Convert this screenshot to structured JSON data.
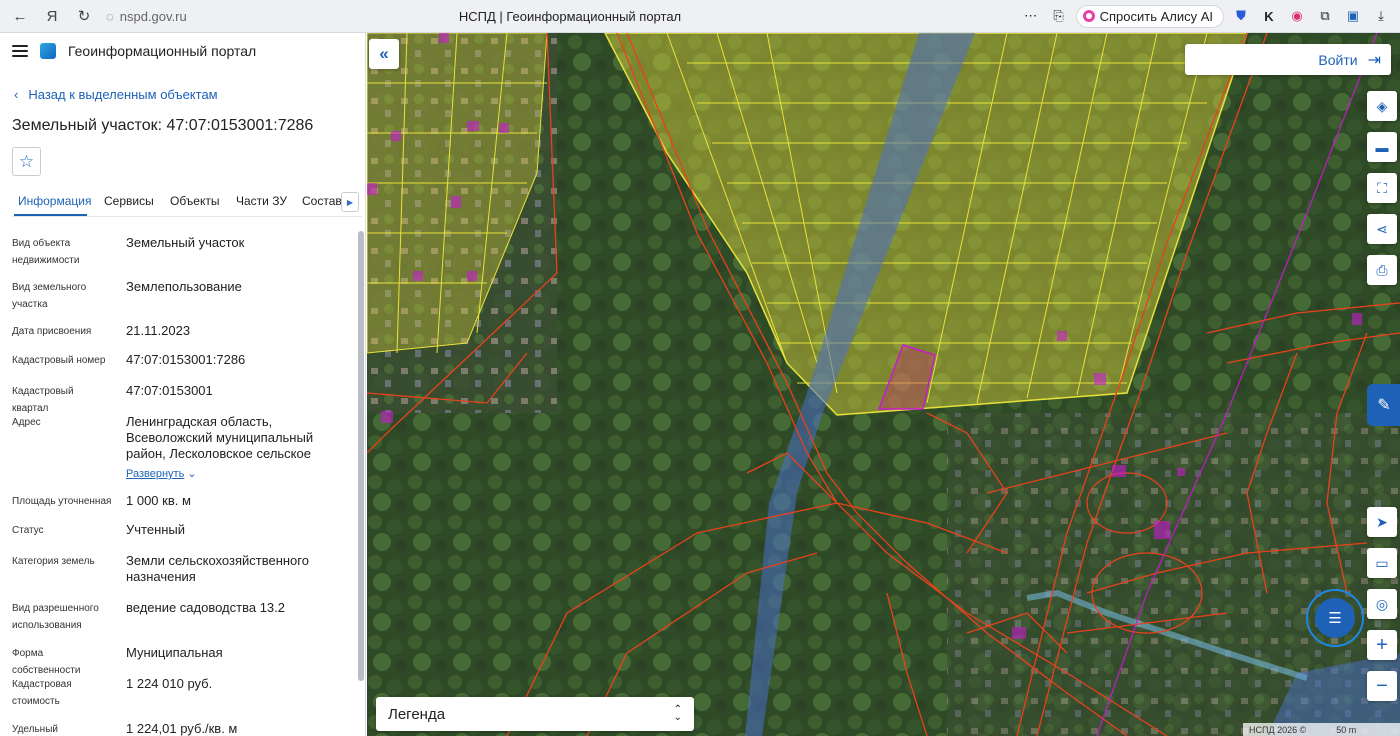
{
  "browser": {
    "url": "nspd.gov.ru",
    "tab_title": "НСПД | Геоинформационный портал",
    "alice_label": "Спросить Алису AI"
  },
  "panel": {
    "app_title": "Геоинформационный портал",
    "back_label": "Назад к выделенным объектам",
    "heading": "Земельный участок: 47:07:0153001:7286",
    "tabs": [
      "Информация",
      "Сервисы",
      "Объекты",
      "Части ЗУ",
      "Состав"
    ],
    "active_tab": "Информация",
    "properties": [
      {
        "label": "Вид объекта недвижимости",
        "value": "Земельный участок"
      },
      {
        "label": "Вид земельного участка",
        "value": "Землепользование"
      },
      {
        "label": "Дата присвоения",
        "value": "21.11.2023"
      },
      {
        "label": "Кадастровый номер",
        "value": "47:07:0153001:7286"
      },
      {
        "label": "Кадастровый квартал",
        "value": "47:07:0153001"
      },
      {
        "label": "Адрес",
        "value": "Ленинградская область, Всеволожский муниципальный район, Лесколовское сельское"
      },
      {
        "label": "Площадь уточненная",
        "value": "1 000 кв. м"
      },
      {
        "label": "Статус",
        "value": "Учтенный"
      },
      {
        "label": "Категория земель",
        "value": "Земли сельскохозяйственного назначения"
      },
      {
        "label": "Вид разрешенного использования",
        "value": "ведение садоводства 13.2"
      },
      {
        "label": "Форма собственности",
        "value": "Муниципальная"
      },
      {
        "label": "Кадастровая стоимость",
        "value": "1 224 010 руб."
      },
      {
        "label": "Удельный показатель",
        "value": "1 224,01 руб./кв. м"
      }
    ],
    "expand_label": "Развернуть"
  },
  "map": {
    "login_label": "Войти",
    "legend_label": "Легенда",
    "copyright": "НСПД 2026 ©",
    "scale": "50 m",
    "colors": {
      "accent": "#1e62b8",
      "parcel_yellow": "#e8e23a",
      "boundary_red": "#e8421c",
      "water_blue": "#4a6fc9",
      "highlight_magenta": "#c81ad0"
    }
  }
}
